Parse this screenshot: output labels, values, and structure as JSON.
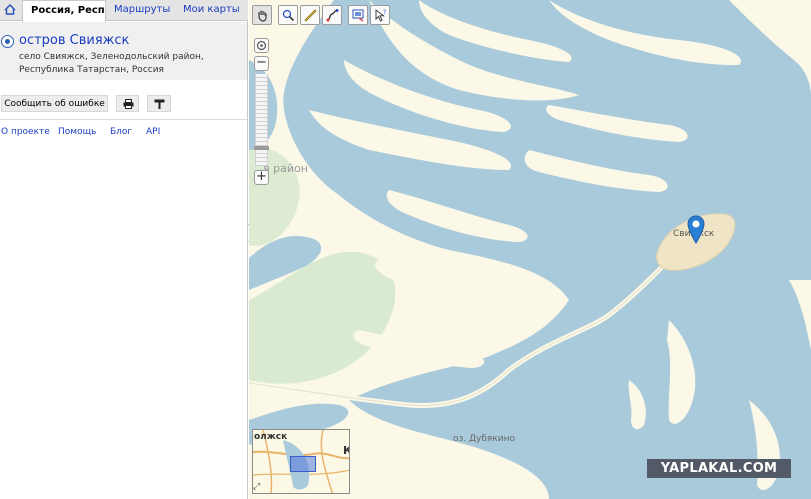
{
  "tabs": {
    "home_icon": "home-icon",
    "search_label": "Россия, Респуб",
    "routes_label": "Маршруты",
    "maps_label": "Мои карты"
  },
  "result": {
    "title": "остров Свияжск",
    "address_line1": "село Свияжск, Зеленодольский район,",
    "address_line2": "Республика Татарстан, Россия"
  },
  "actions": {
    "report_label": "Сообщить об ошибке",
    "print_icon": "printer-icon",
    "paint_icon": "paint-roller-icon"
  },
  "footer_links": {
    "about": "О проекте",
    "help": "Помощь",
    "blog": "Блог",
    "api": "API"
  },
  "map": {
    "labels": {
      "district": "я район",
      "island": "Свияжск",
      "lake": "оз. Дубякино"
    },
    "toolbar": [
      "hand-icon",
      "zoom-icon",
      "ruler-icon",
      "route-icon",
      "print-icon",
      "info-cursor-icon"
    ],
    "zoom": {
      "reset": "compass-icon",
      "out": "−",
      "in": "+",
      "level_fraction": 0.82
    },
    "minimap": {
      "label": "олжск",
      "letter": "К"
    },
    "watermark": "YAPLAKAL.COM",
    "colors": {
      "water": "#a9cadb",
      "land": "#fbf8e8",
      "green": "#d9ead0",
      "island": "#f0e4c6"
    }
  }
}
